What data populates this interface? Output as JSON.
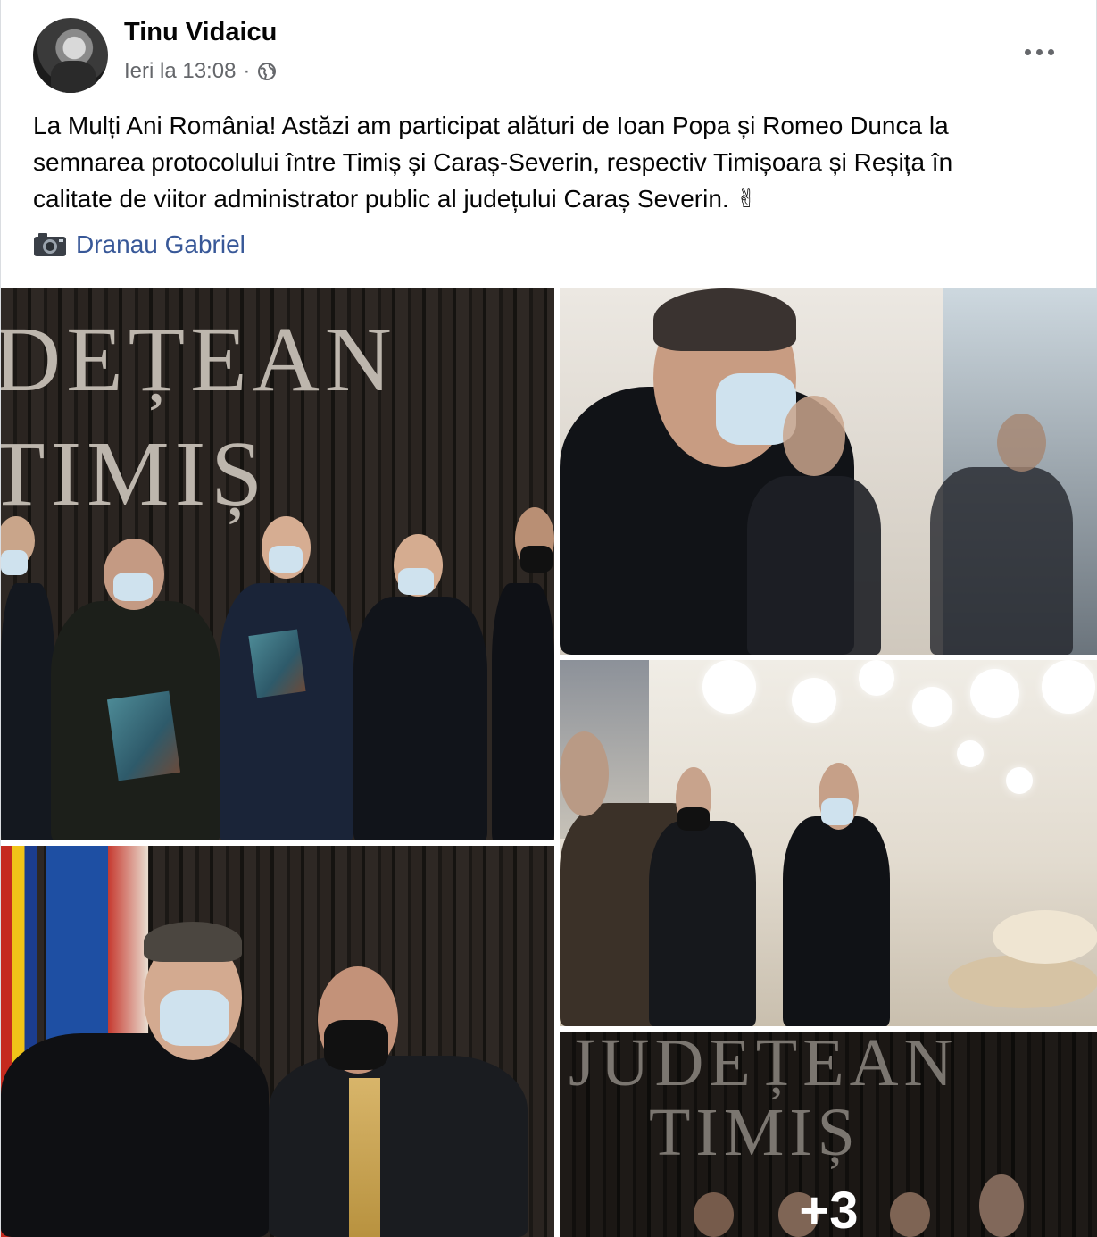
{
  "post": {
    "author": "Tinu Vidaicu",
    "timestamp": "Ieri la 13:08",
    "audience_icon": "globe-icon",
    "more_icon": "more-options-icon",
    "text_lines": [
      "La Mulți Ani România! Astăzi am participat alături de Ioan Popa și Romeo Dunca la",
      "semnarea protocolului între Timiș și Caraș-Severin, respectiv Timișoara și Reșița în",
      "calitate de viitor administrator public al județului Caraș Severin. ✌"
    ],
    "photo_credit": {
      "icon": "camera-icon",
      "name": "Dranau Gabriel"
    }
  },
  "photos": {
    "photo1": {
      "wall_line1": "DEȚEAN",
      "wall_line2": "TIMIȘ"
    },
    "photo5": {
      "wall_line1": "JUDEȚEAN",
      "wall_line2": "TIMIȘ"
    },
    "more_count": "+3"
  },
  "colors": {
    "link": "#385898",
    "secondary_text": "#65676b"
  }
}
